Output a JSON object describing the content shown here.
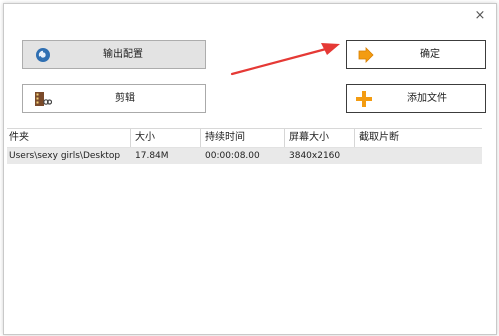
{
  "dialog": {
    "close_glyph": "×"
  },
  "buttons": {
    "output_config": {
      "label": "输出配置",
      "icon": "settings-disc-icon"
    },
    "cut": {
      "label": "剪辑",
      "icon": "film-cut-icon"
    },
    "ok": {
      "label": "确定",
      "icon": "arrow-right-icon"
    },
    "add_file": {
      "label": "添加文件",
      "icon": "plus-icon"
    }
  },
  "annotation": {
    "type": "red-arrow",
    "color": "#e53935",
    "points_to": "ok-button"
  },
  "table": {
    "columns": [
      "件夹",
      "大小",
      "持续时间",
      "屏幕大小",
      "截取片断"
    ],
    "rows": [
      [
        "Users\\sexy girls\\Desktop",
        "17.84M",
        "00:00:08.00",
        "3840x2160",
        ""
      ]
    ]
  },
  "colors": {
    "selected_row": "#e9e9e9",
    "button_gray": "#e3e3e3",
    "accent_orange": "#f39c12"
  }
}
